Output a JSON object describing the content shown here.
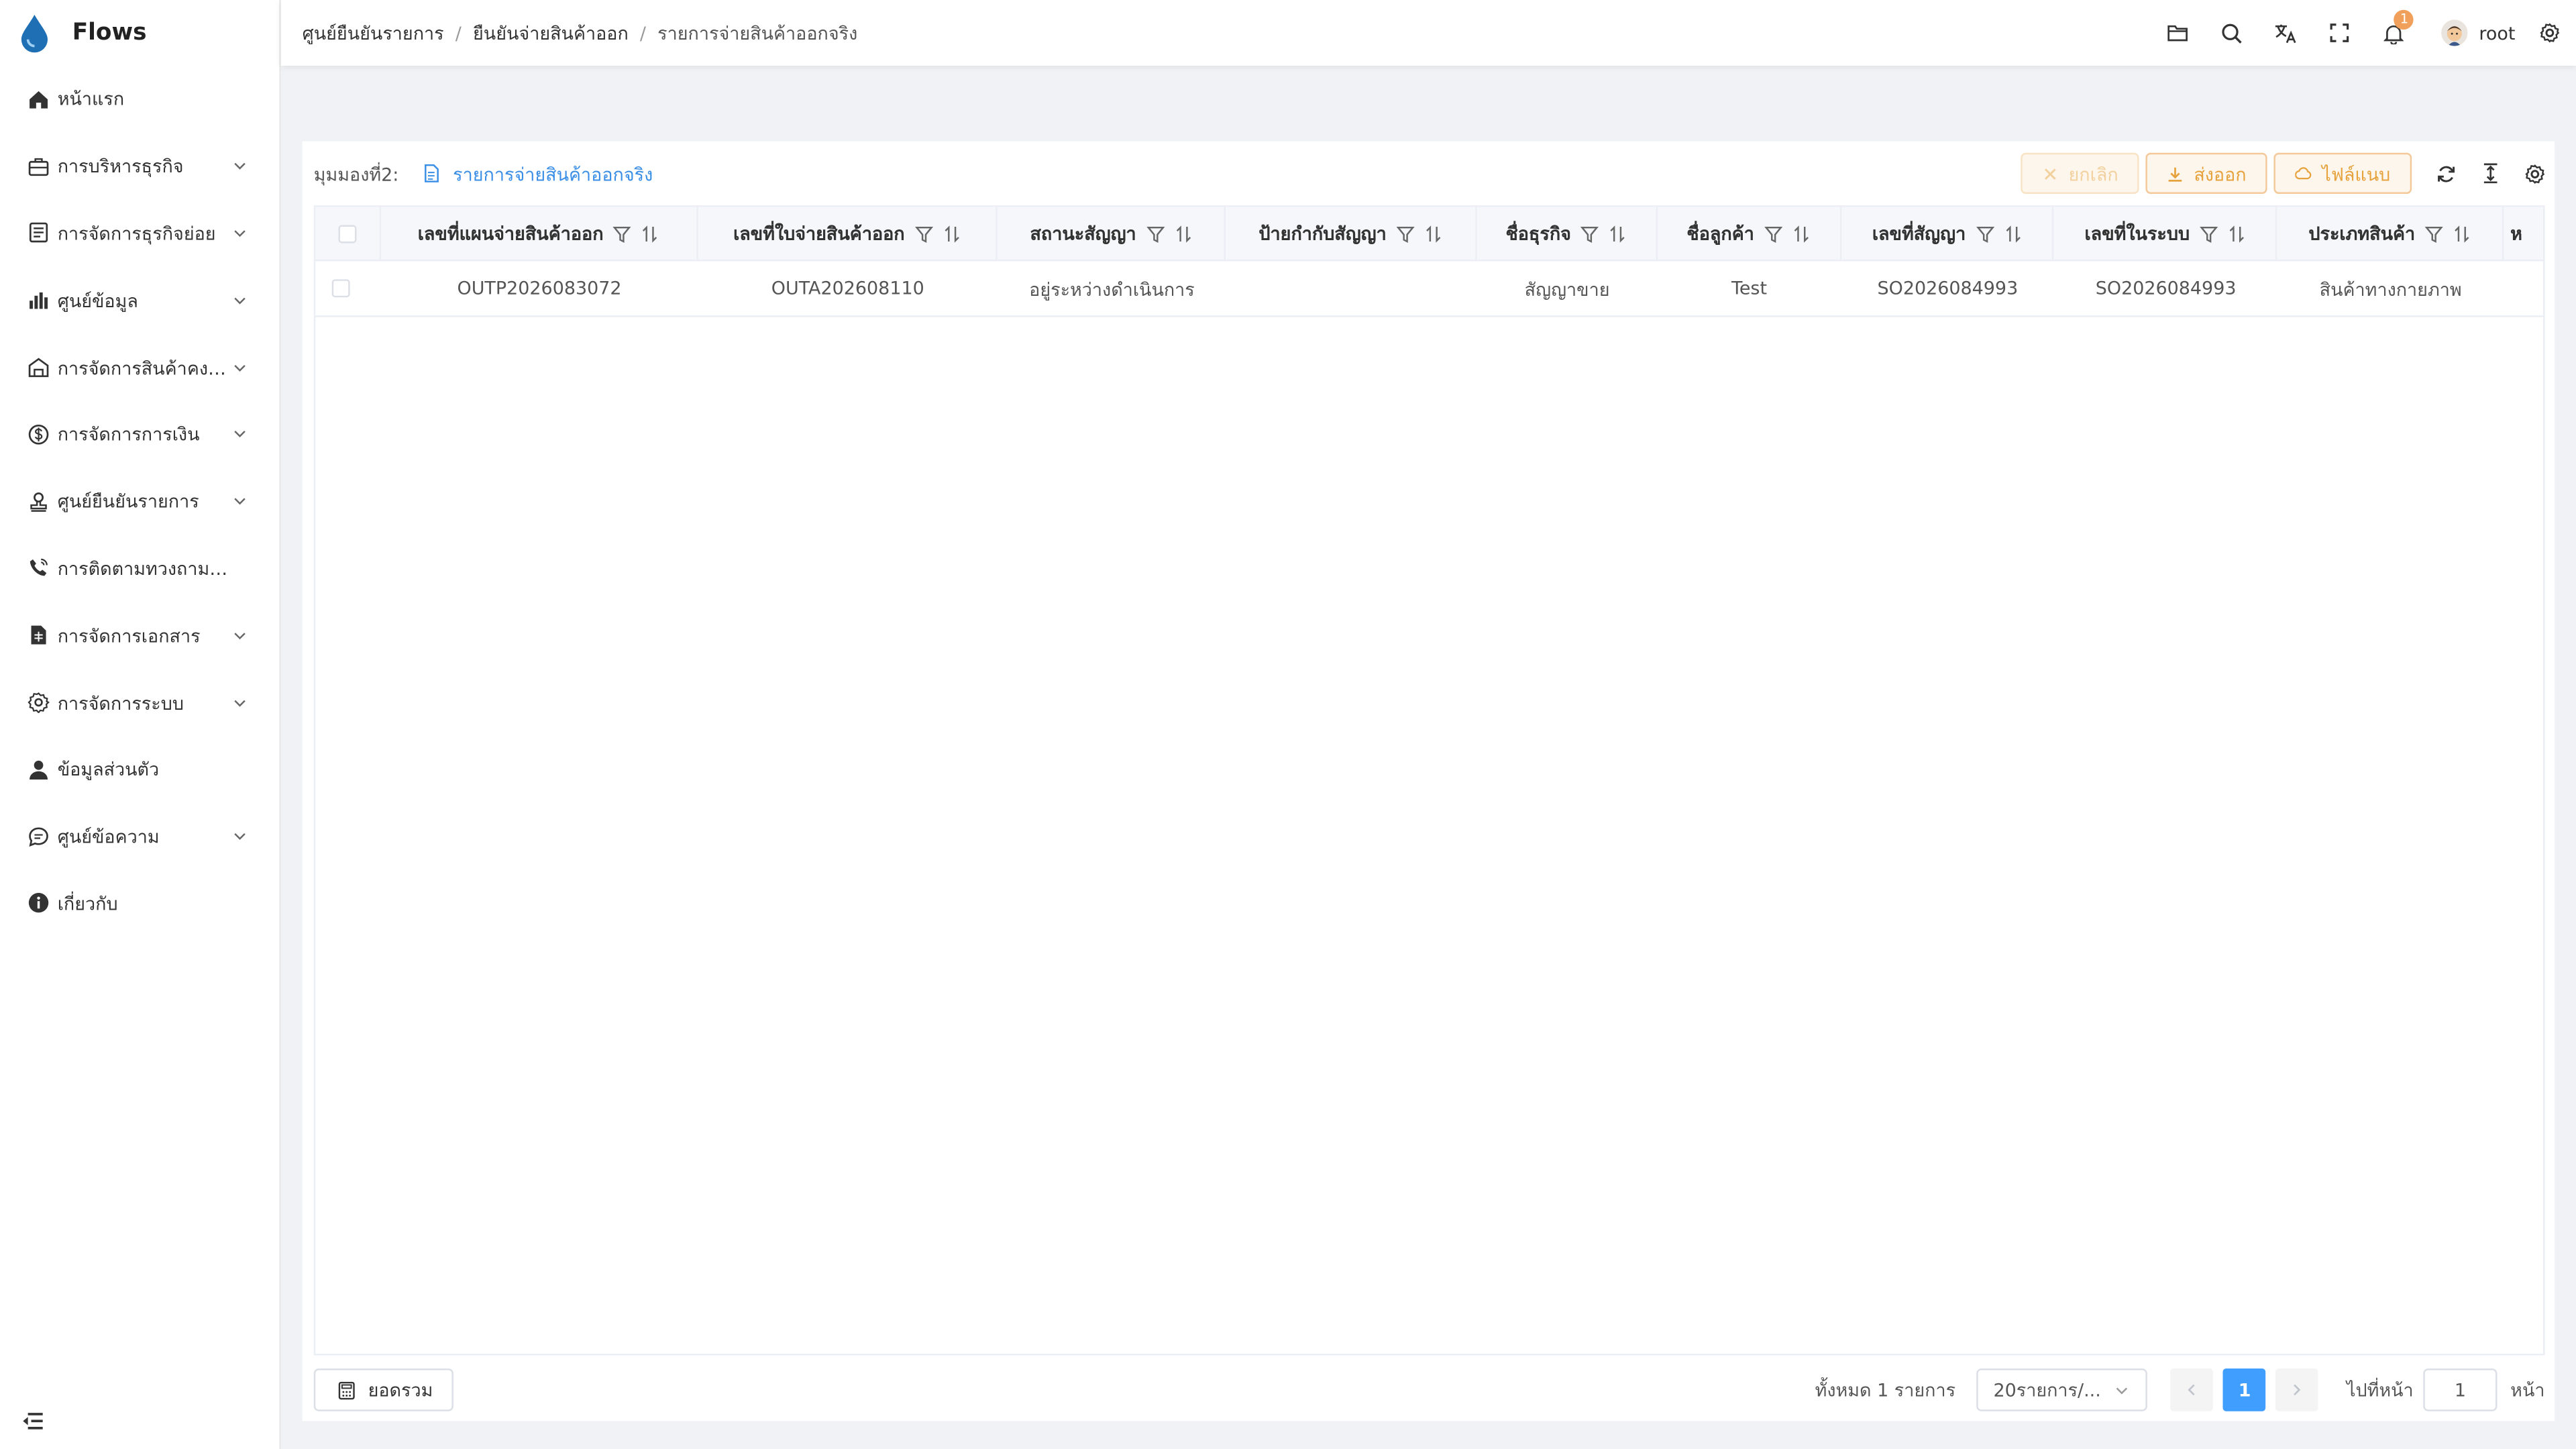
{
  "app": {
    "name": "Flows"
  },
  "sidebar": {
    "items": [
      {
        "label": "หน้าแรก",
        "icon": "home-icon",
        "expandable": false
      },
      {
        "label": "การบริหารธุรกิจ",
        "icon": "briefcase-icon",
        "expandable": true
      },
      {
        "label": "การจัดการธุรกิจย่อย",
        "icon": "document-list-icon",
        "expandable": true
      },
      {
        "label": "ศูนย์ข้อมูล",
        "icon": "bar-chart-icon",
        "expandable": true
      },
      {
        "label": "การจัดการสินค้าคงคลัง",
        "icon": "warehouse-icon",
        "expandable": true
      },
      {
        "label": "การจัดการการเงิน",
        "icon": "money-circle-icon",
        "expandable": true
      },
      {
        "label": "ศูนย์ยืนยันรายการ",
        "icon": "stamp-icon",
        "expandable": true
      },
      {
        "label": "การติดตามทวงถามหนี้",
        "icon": "phone-icon",
        "expandable": false
      },
      {
        "label": "การจัดการเอกสาร",
        "icon": "file-icon",
        "expandable": true
      },
      {
        "label": "การจัดการระบบ",
        "icon": "gear-icon",
        "expandable": true
      },
      {
        "label": "ข้อมูลส่วนตัว",
        "icon": "user-icon",
        "expandable": false
      },
      {
        "label": "ศูนย์ข้อความ",
        "icon": "message-icon",
        "expandable": true
      },
      {
        "label": "เกี่ยวกับ",
        "icon": "info-icon",
        "expandable": false
      }
    ]
  },
  "header": {
    "breadcrumb": [
      "ศูนย์ยืนยันรายการ",
      "ยืนยันจ่ายสินค้าออก",
      "รายการจ่ายสินค้าออกจริง"
    ],
    "notification_count": "1",
    "username": "root"
  },
  "toolbar": {
    "view_label": "มุมมองที่2:",
    "view_name": "รายการจ่ายสินค้าออกจริง",
    "cancel_label": "ยกเลิก",
    "export_label": "ส่งออก",
    "attachment_label": "ไฟล์แนบ"
  },
  "table": {
    "columns": [
      "เลขที่แผนจ่ายสินค้าออก",
      "เลขที่ใบจ่ายสินค้าออก",
      "สถานะสัญญา",
      "ป้ายกำกับสัญญา",
      "ชื่อธุรกิจ",
      "ชื่อลูกค้า",
      "เลขที่สัญญา",
      "เลขที่ในระบบ",
      "ประเภทสินค้า",
      "ห"
    ],
    "rows": [
      [
        "OUTP2026083072",
        "OUTA202608110",
        "อยู่ระหว่างดำเนินการ",
        "",
        "สัญญาขาย",
        "Test",
        "SO2026084993",
        "SO2026084993",
        "สินค้าทางกายภาพ",
        ""
      ]
    ]
  },
  "footer": {
    "summary_label": "ยอดรวม",
    "total_text": "ทั้งหมด 1 รายการ",
    "page_size": "20รายการ/...",
    "current_page": "1",
    "goto_label": "ไปที่หน้า",
    "goto_value": "1",
    "goto_suffix": "หน้า"
  }
}
